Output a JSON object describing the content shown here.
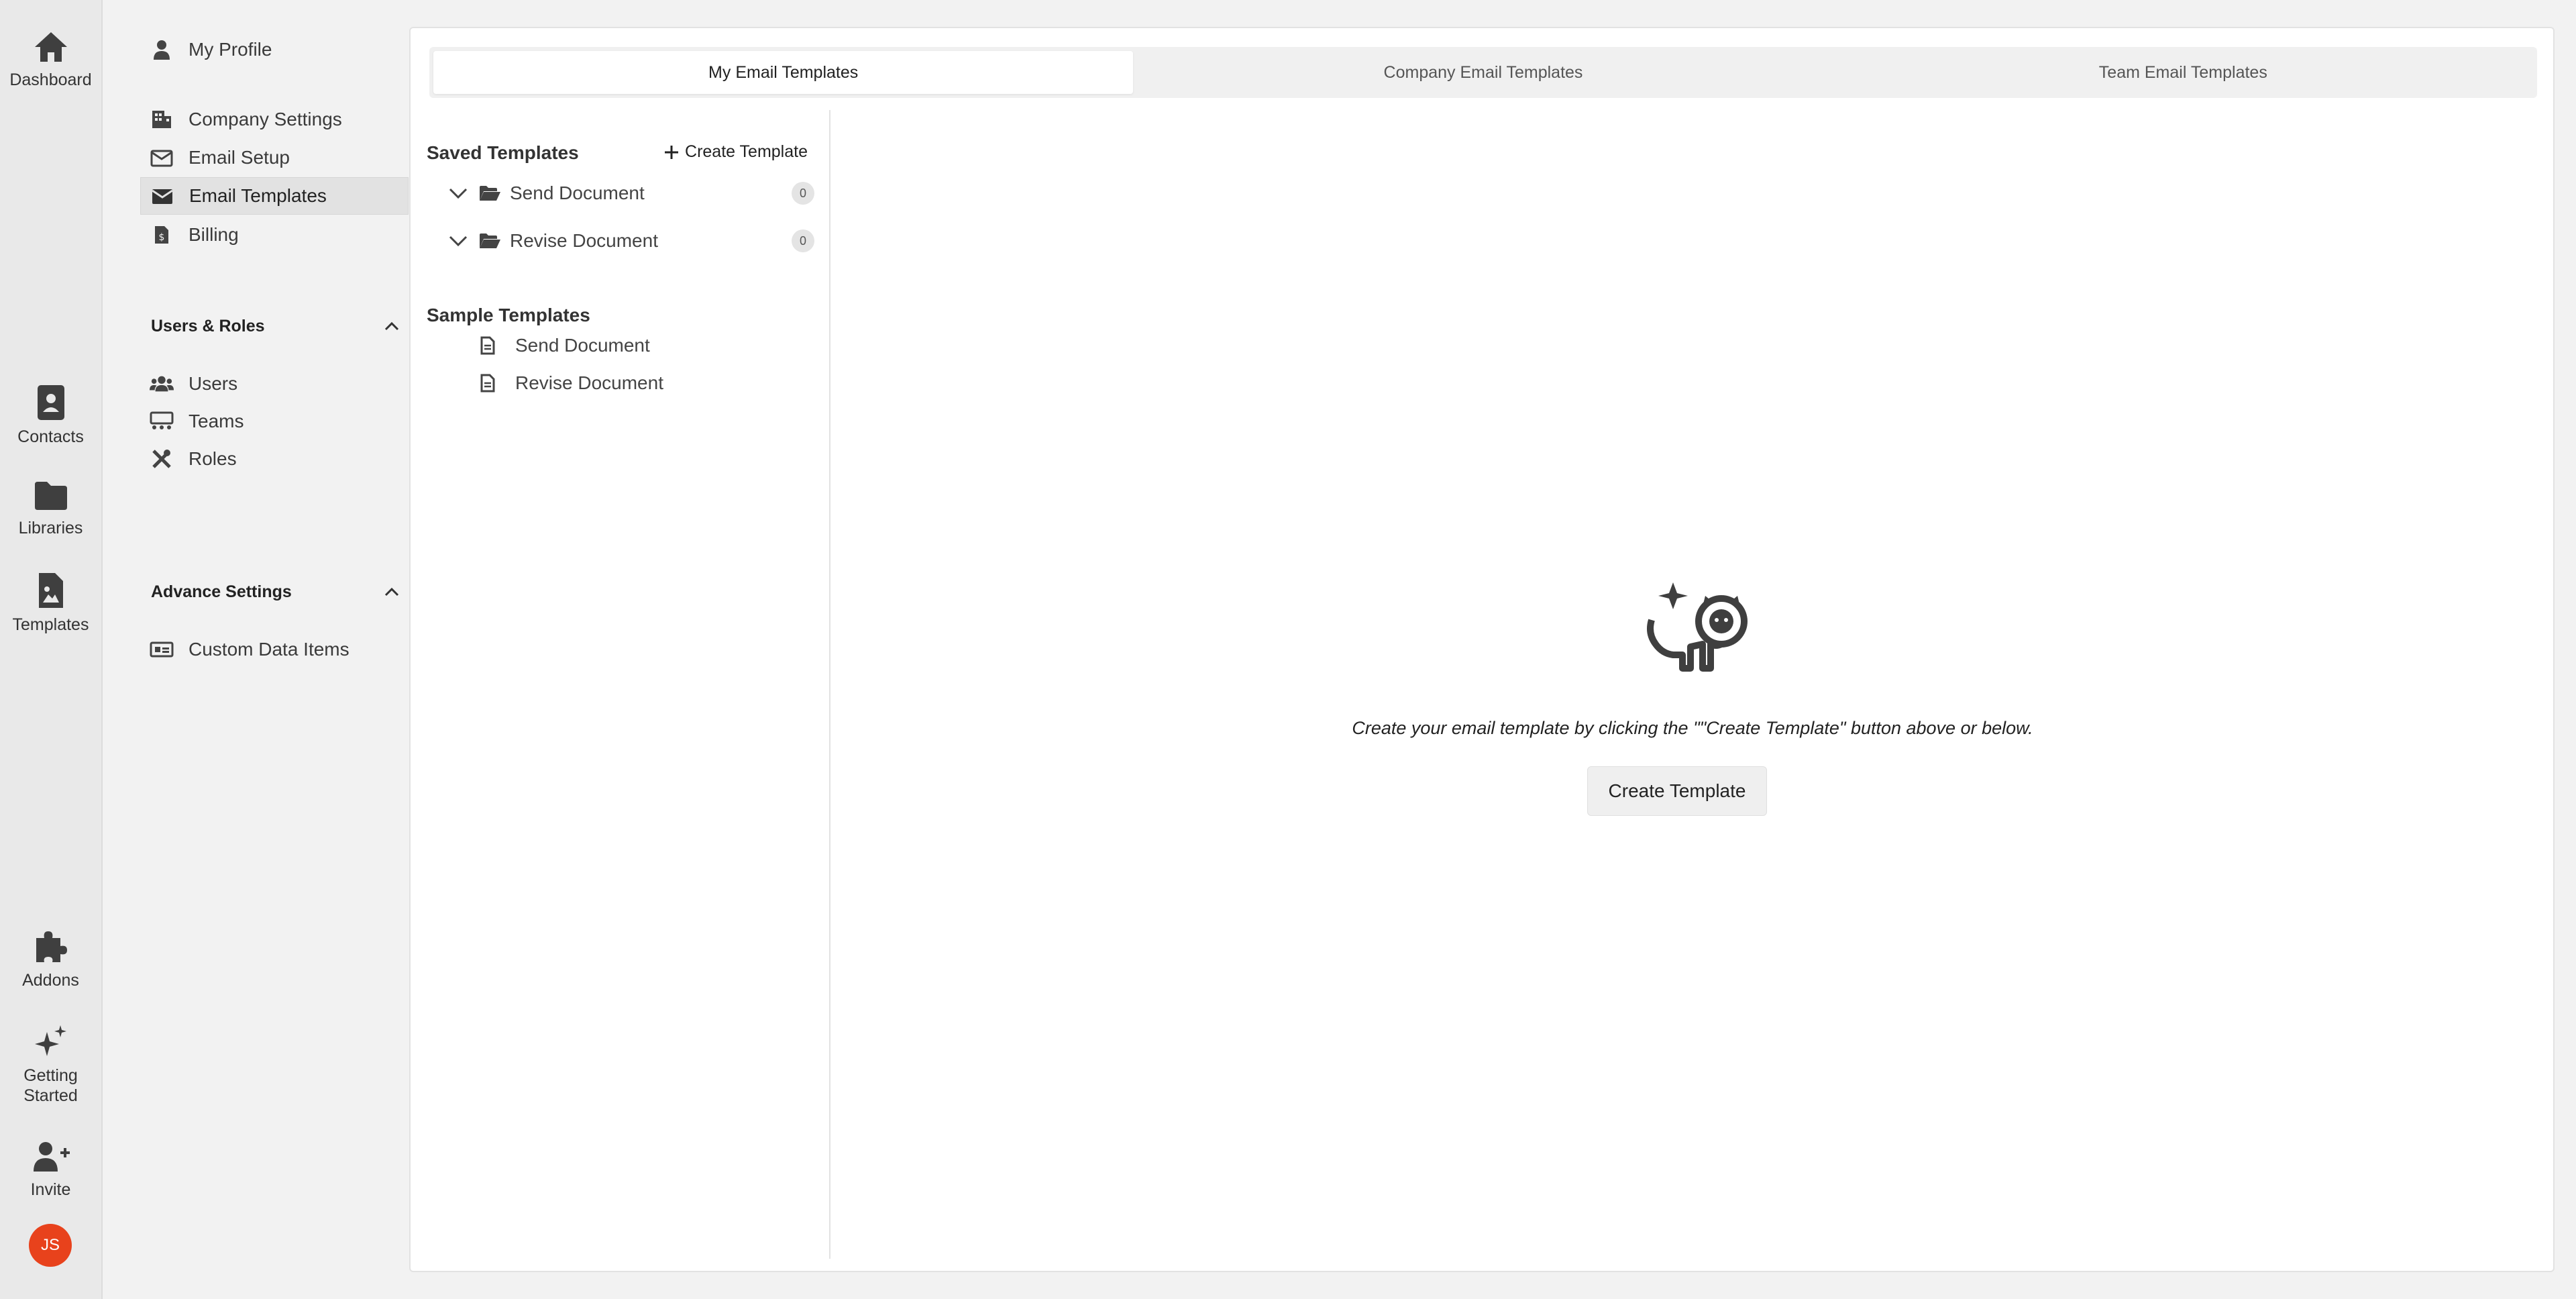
{
  "rail": {
    "items": [
      {
        "label": "Dashboard",
        "icon": "home-icon"
      },
      {
        "label": "Contacts",
        "icon": "contacts-icon"
      },
      {
        "label": "Libraries",
        "icon": "folder-icon"
      },
      {
        "label": "Templates",
        "icon": "template-icon"
      },
      {
        "label": "Addons",
        "icon": "puzzle-icon"
      },
      {
        "label": "Getting Started",
        "icon": "sparkle-icon"
      },
      {
        "label": "Invite",
        "icon": "user-plus-icon"
      }
    ],
    "getting_started_line1": "Getting",
    "getting_started_line2": "Started",
    "avatar_initials": "JS",
    "avatar_color": "#e8421c"
  },
  "settings_nav": {
    "my_profile": "My Profile",
    "company_settings": "Company Settings",
    "email_setup": "Email Setup",
    "email_templates": "Email Templates",
    "billing": "Billing",
    "users_roles_header": "Users & Roles",
    "users": "Users",
    "teams": "Teams",
    "roles": "Roles",
    "advance_settings_header": "Advance Settings",
    "custom_data_items": "Custom Data Items"
  },
  "tabs": {
    "my": "My Email Templates",
    "company": "Company Email Templates",
    "team": "Team Email Templates"
  },
  "templates": {
    "saved_title": "Saved Templates",
    "create_label": "Create Template",
    "folders": [
      {
        "name": "Send Document",
        "count": "0"
      },
      {
        "name": "Revise Document",
        "count": "0"
      }
    ],
    "sample_title": "Sample Templates",
    "samples": [
      "Send Document",
      "Revise Document"
    ]
  },
  "empty_state": {
    "message": "Create your email template by clicking the \"\"Create Template\" button above or below.",
    "button": "Create Template"
  }
}
